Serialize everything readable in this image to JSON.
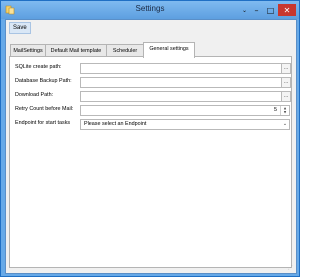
{
  "window": {
    "title": "Settings"
  },
  "window_controls": {
    "menu": "⌄",
    "minimize": "–",
    "maximize": "□",
    "close": "✕"
  },
  "menubar": {
    "save_label": "Save"
  },
  "tabs": [
    {
      "label": "MailSettings"
    },
    {
      "label": "Default Mail template"
    },
    {
      "label": "Scheduler"
    },
    {
      "label": "General settings",
      "active": true
    }
  ],
  "form": {
    "sqlite_label": "SQLite create path:",
    "sqlite_value": "",
    "backup_label": "Database Backup Path:",
    "backup_value": "",
    "download_label": "Download Path:",
    "download_value": "",
    "browse_label": "...",
    "retry_label": "Retry Count before Mail:",
    "retry_value": "5",
    "endpoint_label": "Endpoint for start tasks",
    "endpoint_selected": "Please select an Endpoint"
  },
  "icons": {
    "app": "settings-app-icon",
    "spin_up": "▲",
    "spin_down": "▼",
    "dropdown": "⌄",
    "grip": "⋰"
  },
  "colors": {
    "title_bar": "#66a9e8",
    "close_button": "#c7372f",
    "panel_bg": "#ffffff",
    "client_bg": "#f0f0f0"
  }
}
